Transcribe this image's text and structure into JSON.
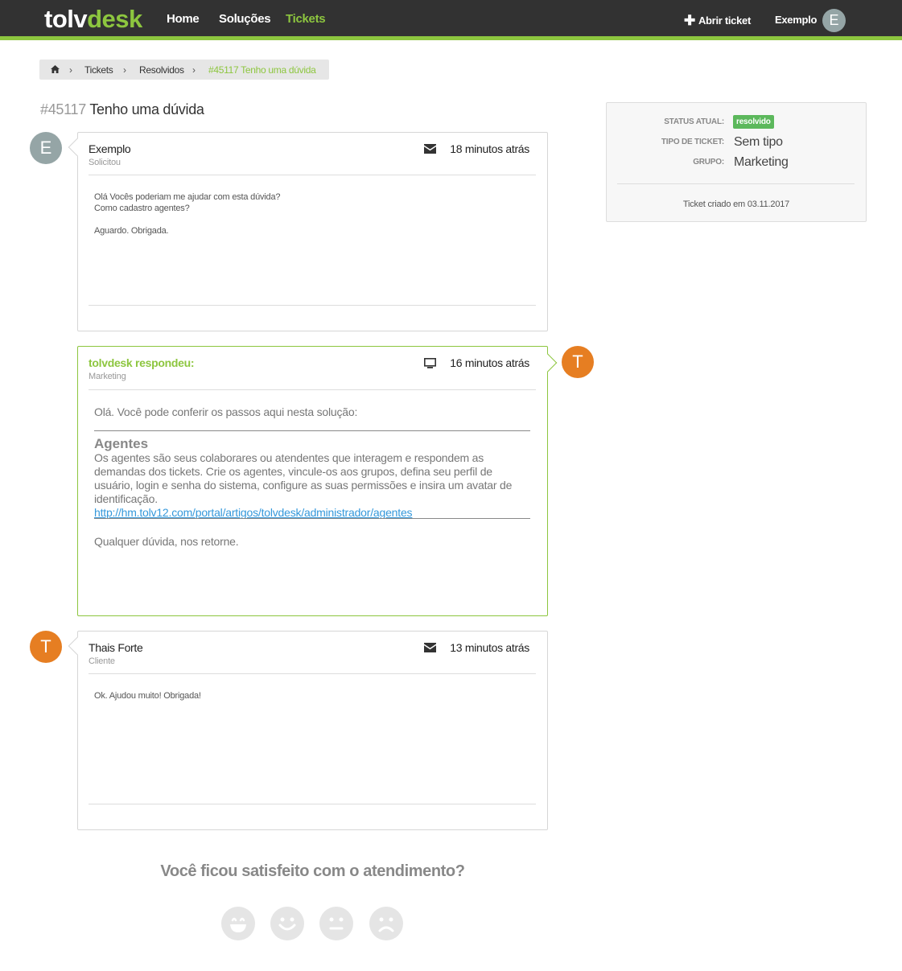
{
  "header": {
    "logo_part1": "tolv",
    "logo_part2": "desk",
    "nav": [
      "Home",
      "Soluções",
      "Tickets"
    ],
    "active_nav": "Tickets",
    "open_ticket_label": "Abrir ticket",
    "user_name": "Exemplo",
    "user_initial": "E",
    "accent_color": "#8dc63f"
  },
  "breadcrumb": {
    "home_icon": "home-icon",
    "items": [
      "Tickets",
      "Resolvidos"
    ],
    "current": "#45117 Tenho uma dúvida"
  },
  "ticket": {
    "number": "#45117",
    "title": "Tenho uma dúvida"
  },
  "messages": [
    {
      "initial": "E",
      "author": "Exemplo",
      "role": "Solicitou",
      "time_icon": "envelope-icon",
      "time": "18 minutos atrás",
      "lines": [
        "Olá Vocês poderiam me ajudar com esta dúvida?",
        "Como cadastro agentes?",
        "",
        "Aguardo. Obrigada."
      ]
    },
    {
      "initial": "T",
      "author": "tolvdesk respondeu:",
      "role": "Marketing",
      "time_icon": "monitor-icon",
      "time": "16 minutos atrás",
      "intro": "Olá. Você pode conferir os passos aqui nesta solução:",
      "article_title": "Agentes",
      "article_desc": "Os agentes são seus colaborares ou atendentes que interagem e respondem as demandas dos tickets. Crie os agentes, vincule-os aos grupos, defina seu perfil de usuário, login e senha do sistema, configure as suas permissões e insira um avatar de identificação.",
      "article_link": "http://hm.tolv12.com/portal/artigos/tolvdesk/administrador/agentes",
      "closing": "Qualquer dúvida, nos retorne."
    },
    {
      "initial": "T",
      "author": "Thais Forte",
      "role": "Cliente",
      "time_icon": "envelope-icon",
      "time": "13 minutos atrás",
      "lines": [
        "Ok. Ajudou muito! Obrigada!"
      ]
    }
  ],
  "sidebar": {
    "status_label": "STATUS ATUAL:",
    "status_value": "resolvido",
    "status_color": "#5cb85c",
    "type_label": "TIPO DE TICKET:",
    "type_value": "Sem tipo",
    "group_label": "GRUPO:",
    "group_value": "Marketing",
    "created": "Ticket criado em 03.11.2017"
  },
  "satisfaction": {
    "question": "Você ficou satisfeito com o atendimento?",
    "faces": [
      "very-happy-face-icon",
      "happy-face-icon",
      "neutral-face-icon",
      "sad-face-icon"
    ]
  }
}
